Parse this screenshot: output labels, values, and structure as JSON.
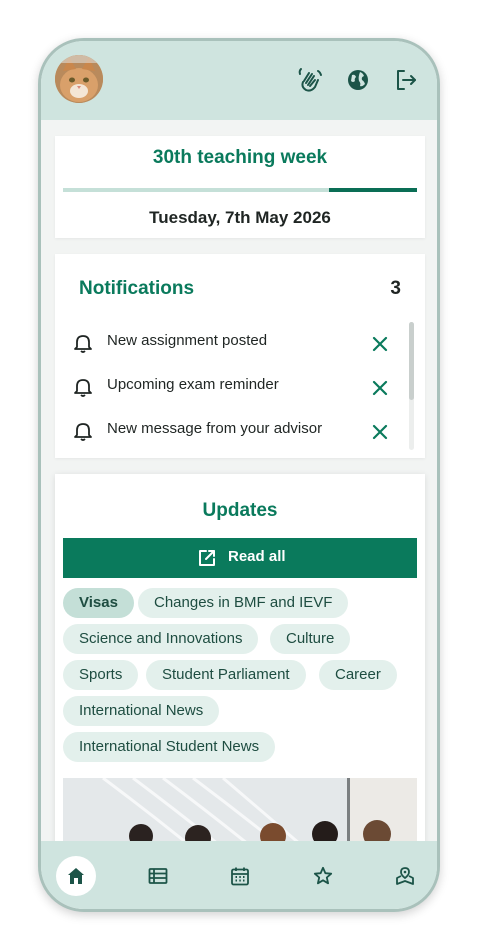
{
  "header": {
    "avatar_alt": "profile avatar",
    "icons": [
      "wave-hand-icon",
      "globe-icon",
      "logout-icon"
    ]
  },
  "week": {
    "title": "30th teaching week",
    "progress": 0.75,
    "date": "Tuesday, 7th May 2026"
  },
  "notifications": {
    "title": "Notifications",
    "count": "3",
    "items": [
      {
        "text": "New assignment posted"
      },
      {
        "text": "Upcoming exam reminder"
      },
      {
        "text": "New message from your advisor"
      }
    ]
  },
  "updates": {
    "title": "Updates",
    "read_all_label": "Read all",
    "chips": [
      {
        "label": "Visas",
        "active": true
      },
      {
        "label": "Changes in BMF and IEVF",
        "active": false
      },
      {
        "label": "Science and Innovations",
        "active": false
      },
      {
        "label": "Culture",
        "active": false
      },
      {
        "label": "Sports",
        "active": false
      },
      {
        "label": "Student Parliament",
        "active": false
      },
      {
        "label": "Career",
        "active": false
      },
      {
        "label": "International News",
        "active": false
      },
      {
        "label": "International Student News",
        "active": false
      }
    ]
  },
  "bottom_nav": {
    "items": [
      "home-icon",
      "list-icon",
      "calendar-icon",
      "star-icon",
      "map-icon"
    ],
    "active": "home-icon"
  },
  "colors": {
    "accent": "#0a7a5c",
    "bar_background": "#cfe4df",
    "chip_background": "#e3f0ec"
  }
}
